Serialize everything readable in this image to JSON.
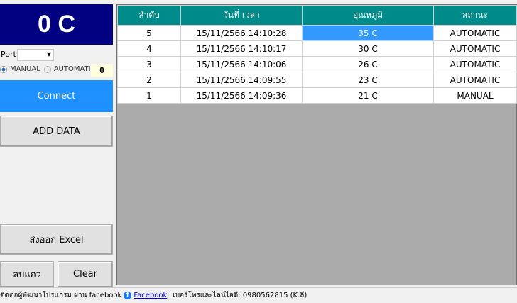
{
  "display": {
    "value": "0 C"
  },
  "port": {
    "label": "Port",
    "value": ""
  },
  "mode": {
    "manual": "MANUAL",
    "automatic": "AUTOMATIC",
    "selected": "MANUAL",
    "counter": "0"
  },
  "buttons": {
    "connect": "Connect",
    "add_data": "ADD DATA",
    "export_excel": "ส่งออก Excel",
    "delete_row": "ลบแถว",
    "clear": "Clear"
  },
  "table": {
    "headers": [
      "ลำดับ",
      "วันที่ เวลา",
      "อุณหภูมิ",
      "สถานะ"
    ],
    "rows": [
      [
        "5",
        "15/11/2566 14:10:28",
        "35 C",
        "AUTOMATIC"
      ],
      [
        "4",
        "15/11/2566 14:10:17",
        "30 C",
        "AUTOMATIC"
      ],
      [
        "3",
        "15/11/2566 14:10:06",
        "26 C",
        "AUTOMATIC"
      ],
      [
        "2",
        "15/11/2566 14:09:55",
        "23 C",
        "AUTOMATIC"
      ],
      [
        "1",
        "15/11/2566 14:09:36",
        "21 C",
        "MANUAL"
      ]
    ]
  },
  "footer": {
    "contact": "ติดต่อผู้พัฒนาโปรแกรม ผ่าน facebook",
    "link": "Facebook",
    "phone": "เบอร์โทรและไลน์ไอดี: 0980562815 (K.ลี)"
  }
}
